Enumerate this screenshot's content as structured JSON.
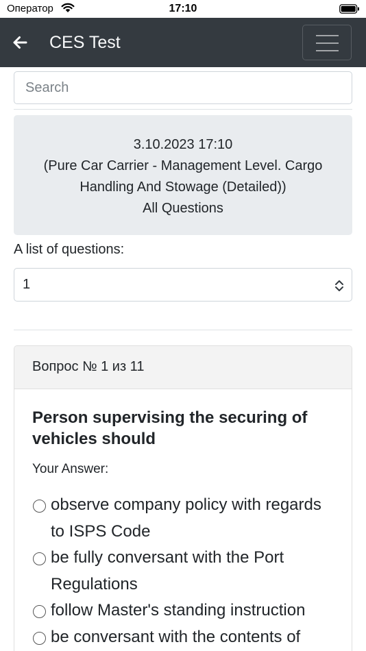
{
  "status_bar": {
    "carrier": "Оператор",
    "time": "17:10"
  },
  "navbar": {
    "title": "CES Test"
  },
  "search": {
    "placeholder": "Search"
  },
  "info": {
    "date": "3.10.2023 17:10",
    "test_name": "(Pure Car Carrier - Management Level. Cargo Handling And Stowage (Detailed))",
    "mode": "All Questions"
  },
  "question_list": {
    "label": "A list of questions:",
    "selected": "1"
  },
  "question_card": {
    "header": "Вопрос № 1 из 11",
    "question": "Person supervising the securing of vehicles should",
    "your_answer_label": "Your Answer:",
    "options": [
      "observe company policy with regards to ISPS Code",
      "be fully conversant with the Port Regulations",
      "follow Master's standing instruction",
      "be conversant with the contents of"
    ]
  }
}
